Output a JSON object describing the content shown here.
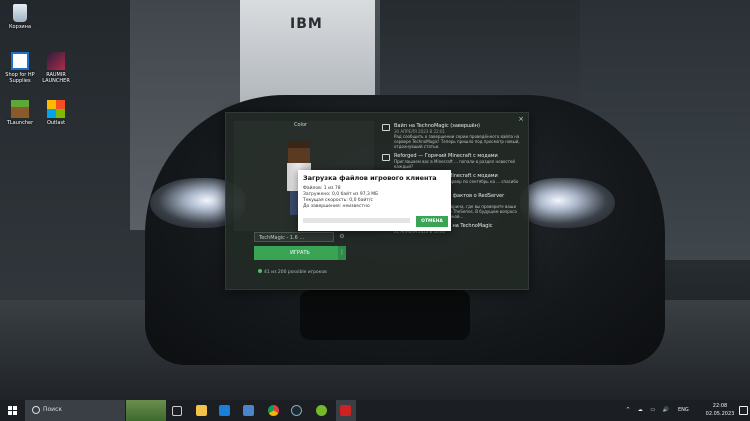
{
  "desktop": {
    "icons": [
      {
        "label": "Корзина"
      },
      {
        "label": "Shop for HP Supplies"
      },
      {
        "label": "RAUMIR LAUNCHER"
      },
      {
        "label": "TLauncher"
      },
      {
        "label": "Outlast"
      }
    ],
    "billboard_text": "IBM"
  },
  "launcher": {
    "close_glyph": "×",
    "skin_label": "Color",
    "version_value": "TechMagic - 1.6 ...",
    "settings_glyph": "⚙",
    "play_label": "ИГРАТЬ",
    "play_more_glyph": "⋮",
    "online_text": "41 из 200 possible игроков",
    "news": [
      {
        "title": "Вайп на TechnoMagic (завершён)",
        "date": "30 АПРЕЛЯ 2023 В 22:01",
        "body": "Рад сообщить о завершении серии проведённого вайпа на сервере TechnoMagic! Теперь пришло под просмотр новый, отдохнувший статьи."
      },
      {
        "title": "Reforged — Горячий Minecraft с модами",
        "date": "",
        "body": "Приглашаем вас в Minecraft ... попали в раздел новостей каждый?"
      },
      {
        "title": "Reforged — Горячий Minecraft с модами",
        "date": "",
        "body": "сервер 22: когда играли сервер по сентябрь на ... спасибо на выше всегда можете"
      },
      {
        "title": "Вехтерины на знание фактов о RedServer",
        "date": "21 АПРЕЛЯ 2023 В 22:14",
        "body": "Уже сегодня пройдёт викторина, где вы проверите ваши знания истории и фактов о TheSeries. В будущем вопроса — а для ... любой праздничной..."
      },
      {
        "title": "Праздничные ивенты на TechnoMagic",
        "date": "21 АПРЕЛЯ 2023 В 16:00",
        "body": ""
      }
    ]
  },
  "dialog": {
    "title": "Загрузка файлов игрового клиента",
    "files": "Файлов: 1 из 78",
    "loaded": "Загружено: 0,0 байт из 97,3 МБ",
    "speed": "Текущая скорость: 0,0 байт/с",
    "remaining": "До завершения: неизвестно",
    "progress": 0.0,
    "cancel_label": "ОТМЕНА"
  },
  "taskbar": {
    "search_placeholder": "Поиск",
    "tray_icons": "^ ☁ ▭ 🔊",
    "lang": "ENG",
    "time": "22:08",
    "date": "02.05.2023"
  },
  "colors": {
    "accent_green": "#3aa455",
    "launcher_bg": "#222a26"
  }
}
